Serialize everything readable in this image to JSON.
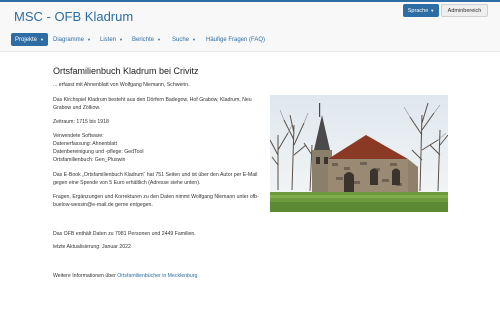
{
  "header": {
    "brand": "MSC - OFB Kladrum",
    "language_button": "Sprache",
    "admin_button": "Adminbereich"
  },
  "nav": {
    "items": [
      {
        "label": "Projekte",
        "has_dropdown": true,
        "active": true
      },
      {
        "label": "Diagramme",
        "has_dropdown": true
      },
      {
        "label": "Listen",
        "has_dropdown": true
      },
      {
        "label": "Berichte",
        "has_dropdown": true
      },
      {
        "label": "Suche",
        "has_dropdown": true
      },
      {
        "label": "Häufige Fragen (FAQ)",
        "has_dropdown": false
      }
    ]
  },
  "content": {
    "title": "Ortsfamilienbuch Kladrum bei Crivitz",
    "subtitle": "... erfasst mit Ahnenblatt von Wolfgang Niemann, Schwerin.",
    "villages": "Das Kirchspiel Kladrum besteht aus den Dörfern Badegow, Hof Grabow, Kladrum, Neu Grabow und Zölkow.",
    "period": "Zeitraum: 1715 bis 1918",
    "software_heading": "Verwendete Software:",
    "software_capture": "Datenerfassung: Ahnenblatt",
    "software_cleanup": "Datenbereinigung und -pflege: GedTool",
    "software_ofb": "Ortsfamilienbuch: Gen_Pluswin",
    "ebook": "Das E-Book „Ortsfamilienbuch Kladrum“ hat 751 Seiten und ist über den Autor per E-Mail gegen eine Spende von 5 Euro erhältlich (Adresse siehe unten).",
    "contact": "Fragen, Ergänzungen und Korrekturen zu den Daten nimmt Wolfgang Niemann unter ofb-buelow-wessin@e-mail.de gerne entgegen.",
    "stats": "Das OFB enthält Daten zu 7981 Personen und 2449 Familien.",
    "updated": "letzte Aktualisierung: Januar 2022",
    "more_prefix": "Weitere Informationen über",
    "more_link": "Ortsfamilienbücher in Mecklenburg"
  },
  "colors": {
    "accent": "#2e6da4",
    "navbar_bg": "#f8f8f8"
  }
}
